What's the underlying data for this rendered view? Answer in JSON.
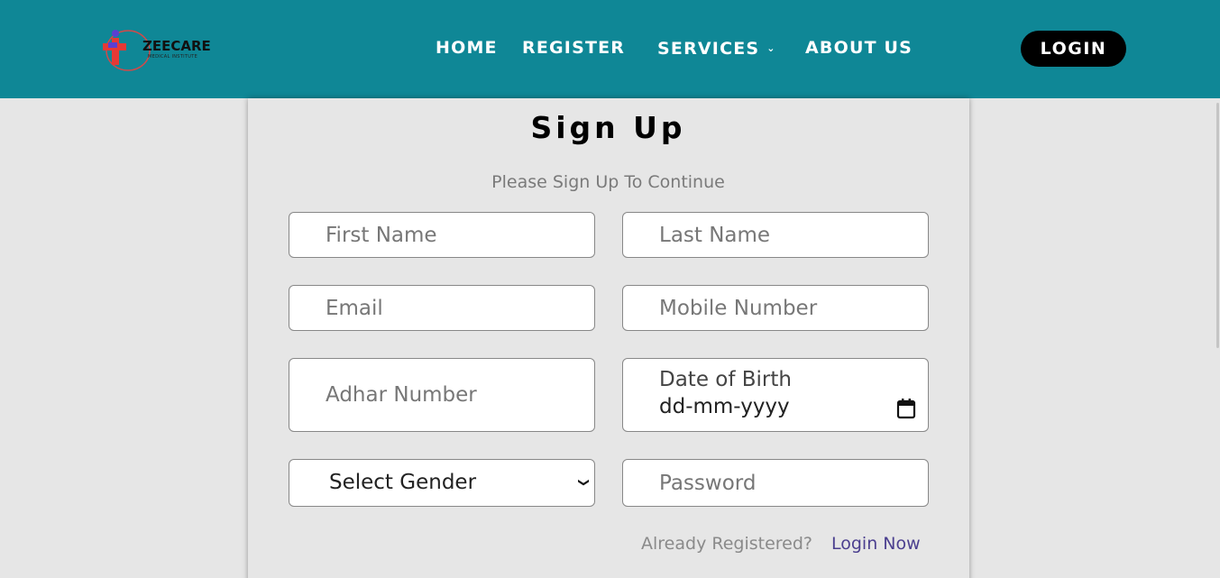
{
  "navbar": {
    "logo_text": "ZEECARE",
    "logo_subtext": "MEDICAL INSTITUTE",
    "links": {
      "home": "HOME",
      "register": "REGISTER",
      "services": "SERVICES",
      "about": "ABOUT US"
    },
    "login_label": "LOGIN",
    "colors": {
      "background": "#0f8796",
      "login_bg": "#000000"
    }
  },
  "form": {
    "title": "Sign Up",
    "subtitle": "Please Sign Up To Continue",
    "first_name_placeholder": "First Name",
    "last_name_placeholder": "Last Name",
    "email_placeholder": "Email",
    "mobile_placeholder": "Mobile Number",
    "adhar_placeholder": "Adhar Number",
    "dob_label": "Date of Birth",
    "dob_value": "dd-mm-yyyy",
    "gender_selected": "Select Gender",
    "password_placeholder": "Password",
    "already_text": "Already Registered?",
    "login_link": "Login Now"
  },
  "icons": {
    "services_dropdown": "chevron-down-icon",
    "dob_calendar": "calendar-icon",
    "gender_dropdown": "chevron-down-icon"
  }
}
